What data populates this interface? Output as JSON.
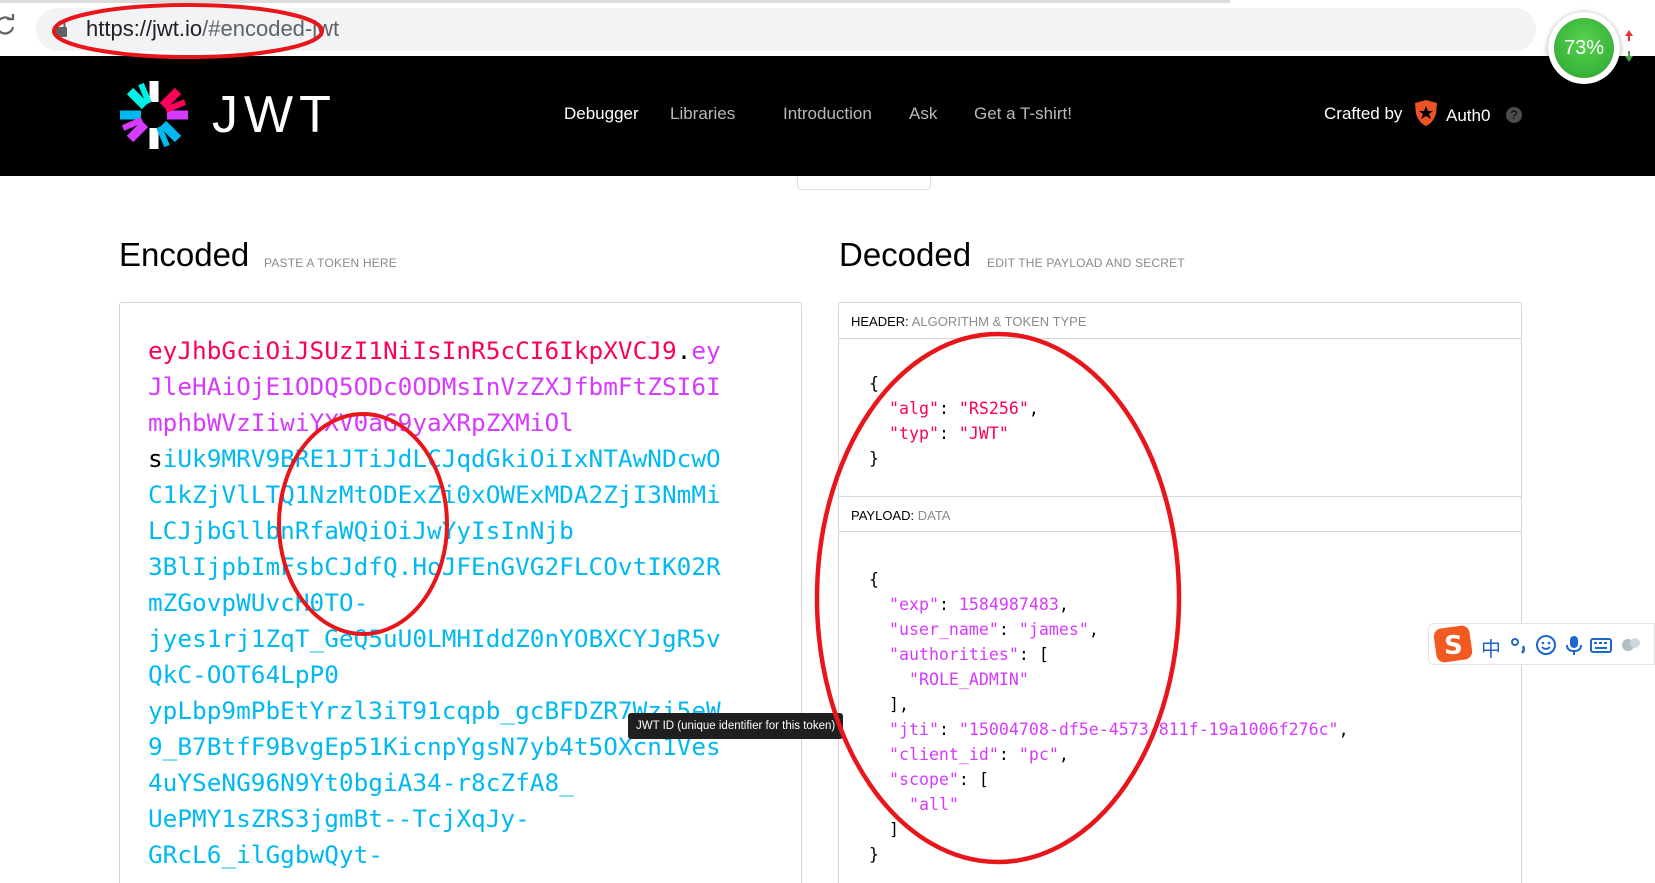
{
  "browser": {
    "url_host": "https://jwt.io",
    "url_path": "/#encoded-jwt",
    "speed_widget_value": "73%"
  },
  "header": {
    "brand": "JWT",
    "nav": [
      {
        "label": "Debugger",
        "active": true
      },
      {
        "label": "Libraries",
        "active": false
      },
      {
        "label": "Introduction",
        "active": false
      },
      {
        "label": "Ask",
        "active": false
      },
      {
        "label": "Get a T-shirt!",
        "active": false
      }
    ],
    "crafted_by": "Crafted by",
    "auth0": "Auth0",
    "help": "?"
  },
  "encoded": {
    "title": "Encoded",
    "subtitle": "PASTE A TOKEN HERE",
    "token_lines": [
      [
        {
          "t": "eyJhbGciOiJSUzI1NiIsInR5cCI6IkpXVCJ9",
          "c": "header"
        },
        {
          "t": ".",
          "c": "dot"
        },
        {
          "t": "ey",
          "c": "payload"
        }
      ],
      [
        {
          "t": "JleHAiOjE1ODQ5ODc0ODMsInVzZXJfbmFtZSI6I",
          "c": "payload"
        }
      ],
      [
        {
          "t": "mphbWVzIiwiYXV0aG9yaXRpZXMiOl",
          "c": "payload"
        }
      ],
      [
        {
          "t": "s",
          "c": "dot"
        },
        {
          "t": "iUk9MRV9BRE1JTiJdLCJqdGkiOiIxNTAwNDcwO",
          "c": "sig"
        }
      ],
      [
        {
          "t": "C1kZjVlLTQ1NzMtODExZi0xOWExMDA2ZjI3NmMi",
          "c": "sig"
        }
      ],
      [
        {
          "t": "LCJjbGllbnRfaWQiOiJwYyIsInNjb",
          "c": "sig"
        }
      ],
      [
        {
          "t": "3BlIjpbImFsbCJdfQ.HoJFEnGVG2FLCOvtIK02R",
          "c": "sig"
        }
      ],
      [
        {
          "t": "mZGovpWUvcH0TO-",
          "c": "sig"
        }
      ],
      [
        {
          "t": "jyes1rj1ZqT_GeQ5uU0LMHIddZ0nYOBXCYJgR5v",
          "c": "sig"
        }
      ],
      [
        {
          "t": "QkC-OOT64LpP0",
          "c": "sig"
        }
      ],
      [
        {
          "t": "ypLbp9mPbEtYrzl3iT91cqpb_gcBFDZR7Wzi5eW",
          "c": "sig"
        }
      ],
      [
        {
          "t": "9_B7BtfF9BvgEp51KicnpYgsN7yb4t5OXcn1Ves",
          "c": "sig"
        }
      ],
      [
        {
          "t": "4uYSeNG96N9Yt0bgiA34-r8cZfA8_",
          "c": "sig"
        }
      ],
      [
        {
          "t": "UePMY1sZRS3jgmBt--TcjXqJy-",
          "c": "sig"
        }
      ],
      [
        {
          "t": "GRcL6_ilGgbwQyt-",
          "c": "sig"
        }
      ]
    ]
  },
  "decoded": {
    "title": "Decoded",
    "subtitle": "EDIT THE PAYLOAD AND SECRET",
    "header_section": {
      "label": "HEADER:",
      "sub": "ALGORITHM & TOKEN TYPE"
    },
    "payload_section": {
      "label": "PAYLOAD:",
      "sub": "DATA"
    },
    "header_json": [
      [
        {
          "t": "{",
          "c": "punc"
        }
      ],
      [
        {
          "t": "  ",
          "c": "punc"
        },
        {
          "t": "\"alg\"",
          "c": "key"
        },
        {
          "t": ": ",
          "c": "punc"
        },
        {
          "t": "\"RS256\"",
          "c": "str"
        },
        {
          "t": ",",
          "c": "punc"
        }
      ],
      [
        {
          "t": "  ",
          "c": "punc"
        },
        {
          "t": "\"typ\"",
          "c": "key"
        },
        {
          "t": ": ",
          "c": "punc"
        },
        {
          "t": "\"JWT\"",
          "c": "str"
        }
      ],
      [
        {
          "t": "}",
          "c": "punc"
        }
      ]
    ],
    "payload_json": [
      [
        {
          "t": "{",
          "c": "punc"
        }
      ],
      [
        {
          "t": "  ",
          "c": "punc"
        },
        {
          "t": "\"exp\"",
          "c": "key"
        },
        {
          "t": ": ",
          "c": "punc"
        },
        {
          "t": "1584987483",
          "c": "num"
        },
        {
          "t": ",",
          "c": "punc"
        }
      ],
      [
        {
          "t": "  ",
          "c": "punc"
        },
        {
          "t": "\"user_name\"",
          "c": "key"
        },
        {
          "t": ": ",
          "c": "punc"
        },
        {
          "t": "\"james\"",
          "c": "str"
        },
        {
          "t": ",",
          "c": "punc"
        }
      ],
      [
        {
          "t": "  ",
          "c": "punc"
        },
        {
          "t": "\"authorities\"",
          "c": "key"
        },
        {
          "t": ": [",
          "c": "punc"
        }
      ],
      [
        {
          "t": "    ",
          "c": "punc"
        },
        {
          "t": "\"ROLE_ADMIN\"",
          "c": "str"
        }
      ],
      [
        {
          "t": "  ],",
          "c": "punc"
        }
      ],
      [
        {
          "t": "  ",
          "c": "punc"
        },
        {
          "t": "\"jti\"",
          "c": "key"
        },
        {
          "t": ": ",
          "c": "punc"
        },
        {
          "t": "\"15004708-df5e-4573-811f-19a1006f276c\"",
          "c": "str"
        },
        {
          "t": ",",
          "c": "punc"
        }
      ],
      [
        {
          "t": "  ",
          "c": "punc"
        },
        {
          "t": "\"client_id\"",
          "c": "key"
        },
        {
          "t": ": ",
          "c": "punc"
        },
        {
          "t": "\"pc\"",
          "c": "str"
        },
        {
          "t": ",",
          "c": "punc"
        }
      ],
      [
        {
          "t": "  ",
          "c": "punc"
        },
        {
          "t": "\"scope\"",
          "c": "key"
        },
        {
          "t": ": [",
          "c": "punc"
        }
      ],
      [
        {
          "t": "    ",
          "c": "punc"
        },
        {
          "t": "\"all\"",
          "c": "str"
        }
      ],
      [
        {
          "t": "  ]",
          "c": "punc"
        }
      ],
      [
        {
          "t": "}",
          "c": "punc"
        }
      ]
    ]
  },
  "tooltip": "JWT ID (unique identifier for this token)",
  "ime": {
    "zh": "中"
  },
  "colors": {
    "header_part": "#fb015b",
    "payload_part": "#d63aff",
    "signature_part": "#00b9f1",
    "annotation": "#e8161b"
  }
}
